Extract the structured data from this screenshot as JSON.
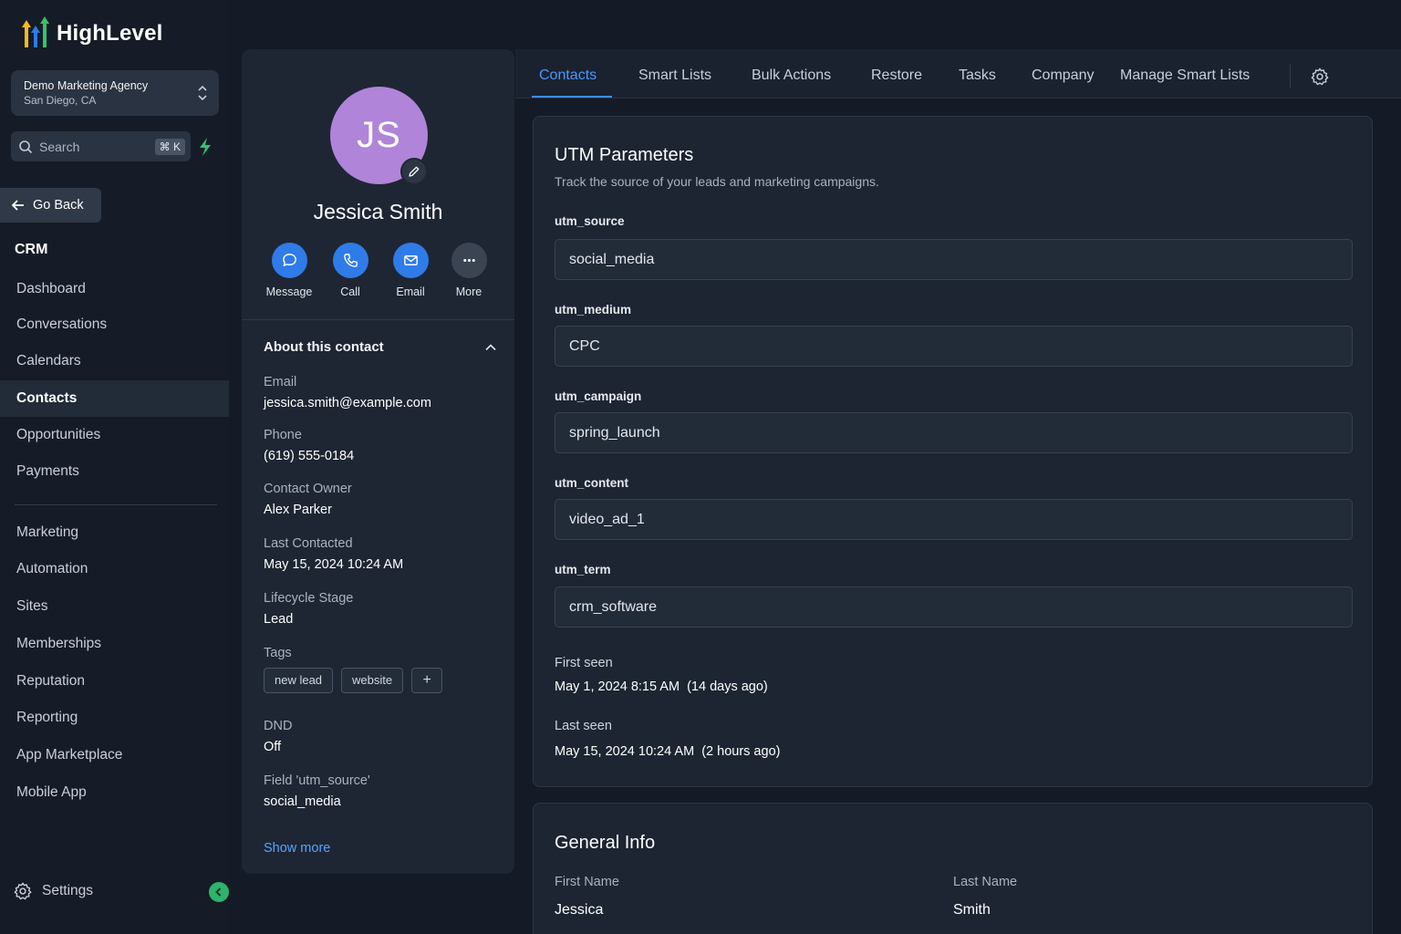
{
  "brand": {
    "name": "HighLevel",
    "accent": "#3f8cff",
    "colors": {
      "logo_yellow": "#f5b921",
      "logo_green": "#3bbf6a",
      "logo_blue": "#2f7be8"
    }
  },
  "agency": {
    "name": "Demo Marketing Agency",
    "location": "San Diego, CA"
  },
  "search": {
    "placeholder": "Search",
    "shortcut": "⌘ K"
  },
  "sidebar": {
    "go_back": "Go Back",
    "section_title": "CRM",
    "items_primary": [
      {
        "label": "Dashboard"
      },
      {
        "label": "Conversations"
      },
      {
        "label": "Calendars"
      },
      {
        "label": "Contacts",
        "active": true
      },
      {
        "label": "Opportunities"
      },
      {
        "label": "Payments"
      }
    ],
    "items_secondary": [
      {
        "label": "Marketing"
      },
      {
        "label": "Automation"
      },
      {
        "label": "Sites"
      },
      {
        "label": "Memberships"
      },
      {
        "label": "Reputation"
      },
      {
        "label": "Reporting"
      },
      {
        "label": "App Marketplace"
      },
      {
        "label": "Mobile App"
      }
    ],
    "settings_label": "Settings"
  },
  "contact": {
    "initials": "JS",
    "avatar_color": "#b084d9",
    "name": "Jessica Smith",
    "actions": [
      {
        "label": "Message",
        "icon": "chat-bubble-icon"
      },
      {
        "label": "Call",
        "icon": "phone-icon"
      },
      {
        "label": "Email",
        "icon": "mail-icon"
      },
      {
        "label": "More",
        "icon": "more-dots-icon"
      }
    ],
    "about_title": "About this contact",
    "fields": [
      {
        "label": "Email",
        "value": "jessica.smith@example.com"
      },
      {
        "label": "Phone",
        "value": "(619) 555-0184"
      },
      {
        "label": "Contact Owner",
        "value": "Alex Parker"
      },
      {
        "label": "Last Contacted",
        "value": "May 15, 2024 10:24 AM"
      },
      {
        "label": "Lifecycle Stage",
        "value": "Lead"
      }
    ],
    "tags_label": "Tags",
    "tags": [
      "new lead",
      "website"
    ],
    "tag_add": "+",
    "extra_fields": [
      {
        "label": "DND",
        "value": "Off"
      },
      {
        "label": "Field 'utm_source'",
        "value": "social_media"
      }
    ],
    "show_more": "Show more"
  },
  "tabs": [
    {
      "label": "Contacts",
      "active": true
    },
    {
      "label": "Smart Lists"
    },
    {
      "label": "Bulk Actions"
    },
    {
      "label": "Restore"
    },
    {
      "label": "Tasks"
    },
    {
      "label": "Company"
    },
    {
      "label": "Manage Smart Lists"
    }
  ],
  "utm": {
    "title": "UTM Parameters",
    "subtitle": "Track the source of your leads and marketing campaigns.",
    "params": [
      {
        "label": "utm_source",
        "value": "social_media"
      },
      {
        "label": "utm_medium",
        "value": "CPC"
      },
      {
        "label": "utm_campaign",
        "value": "spring_launch"
      },
      {
        "label": "utm_content",
        "value": "video_ad_1"
      },
      {
        "label": "utm_term",
        "value": "crm_software"
      }
    ],
    "first_seen_label": "First seen",
    "first_seen_value": "May 1, 2024 8:15 AM  (14 days ago)",
    "last_seen_label": "Last seen",
    "last_seen_value": "May 15, 2024 10:24 AM  (2 hours ago)"
  },
  "general_info": {
    "title": "General Info",
    "first_name_label": "First Name",
    "first_name": "Jessica",
    "last_name_label": "Last Name",
    "last_name": "Smith"
  }
}
